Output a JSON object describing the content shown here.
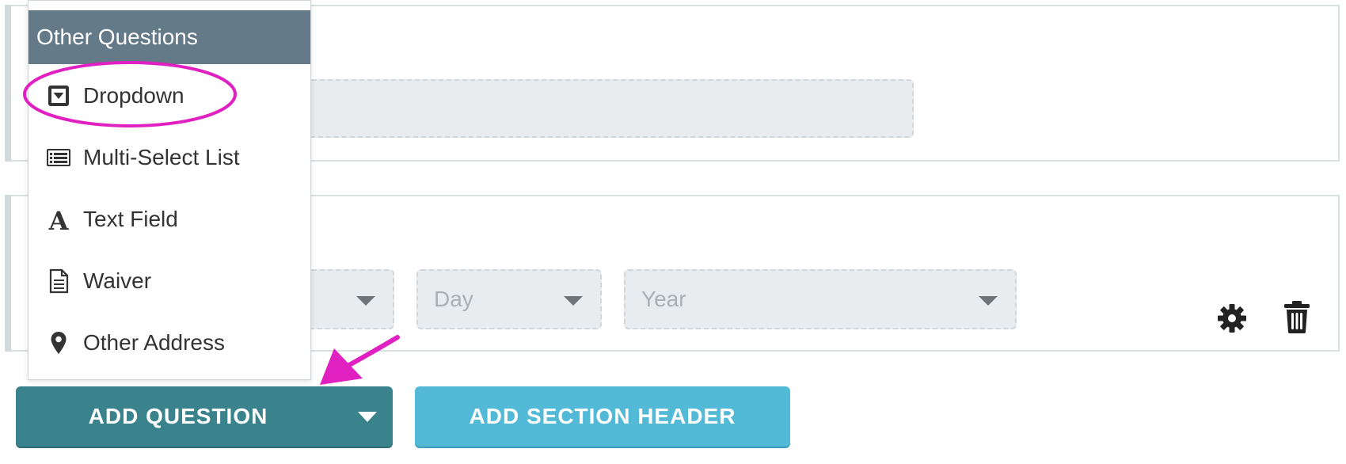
{
  "menu": {
    "header": "Other Questions",
    "items": [
      {
        "label": "Dropdown",
        "icon": "dropdown-icon"
      },
      {
        "label": "Multi-Select List",
        "icon": "list-icon"
      },
      {
        "label": "Text Field",
        "icon": "text-field-icon"
      },
      {
        "label": "Waiver",
        "icon": "document-icon"
      },
      {
        "label": "Other Address",
        "icon": "map-pin-icon"
      }
    ]
  },
  "date_selects": {
    "day_placeholder": "Day",
    "year_placeholder": "Year"
  },
  "buttons": {
    "add_question": "ADD QUESTION",
    "add_section_header": "ADD SECTION HEADER"
  },
  "colors": {
    "menu_header_bg": "#647a88",
    "add_question_bg": "#3a838c",
    "add_section_bg": "#52b9d7",
    "annotation": "#e020c0"
  }
}
